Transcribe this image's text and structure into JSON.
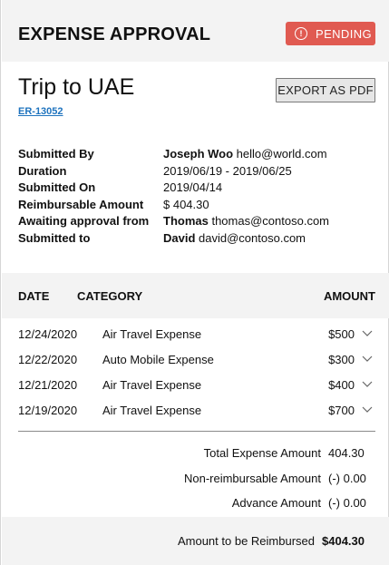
{
  "header": {
    "title": "EXPENSE APPROVAL",
    "status_badge": {
      "icon": "alert-circle-icon",
      "label": "PENDING",
      "color": "#e05a51"
    }
  },
  "trip": {
    "title": "Trip to UAE",
    "id": "ER-13052",
    "export_label": "EXPORT AS PDF"
  },
  "details": [
    {
      "label": "Submitted By",
      "name": "Joseph Woo",
      "value": "hello@world.com"
    },
    {
      "label": "Duration",
      "name": "",
      "value": "2019/06/19 - 2019/06/25"
    },
    {
      "label": "Submitted On",
      "name": "",
      "value": "2019/04/14"
    },
    {
      "label": "Reimbursable Amount",
      "name": "",
      "value": "$ 404.30"
    },
    {
      "label": "Awaiting approval from",
      "name": "Thomas",
      "value": "thomas@contoso.com"
    },
    {
      "label": "Submitted to",
      "name": "David",
      "value": "david@contoso.com"
    }
  ],
  "table": {
    "headers": {
      "date": "DATE",
      "category": "CATEGORY",
      "amount": "AMOUNT"
    },
    "rows": [
      {
        "date": "12/24/2020",
        "category": "Air Travel Expense",
        "amount": "$500"
      },
      {
        "date": "12/22/2020",
        "category": "Auto Mobile Expense",
        "amount": "$300"
      },
      {
        "date": "12/21/2020",
        "category": "Air Travel Expense",
        "amount": "$400"
      },
      {
        "date": "12/19/2020",
        "category": "Air Travel Expense",
        "amount": "$700"
      }
    ]
  },
  "summary": [
    {
      "label": "Total Expense Amount",
      "value": "404.30"
    },
    {
      "label": "Non-reimbursable Amount",
      "value": "(-) 0.00"
    },
    {
      "label": "Advance Amount",
      "value": "(-) 0.00"
    }
  ],
  "footer": {
    "label": "Amount to be Reimbursed",
    "value": "$404.30"
  }
}
